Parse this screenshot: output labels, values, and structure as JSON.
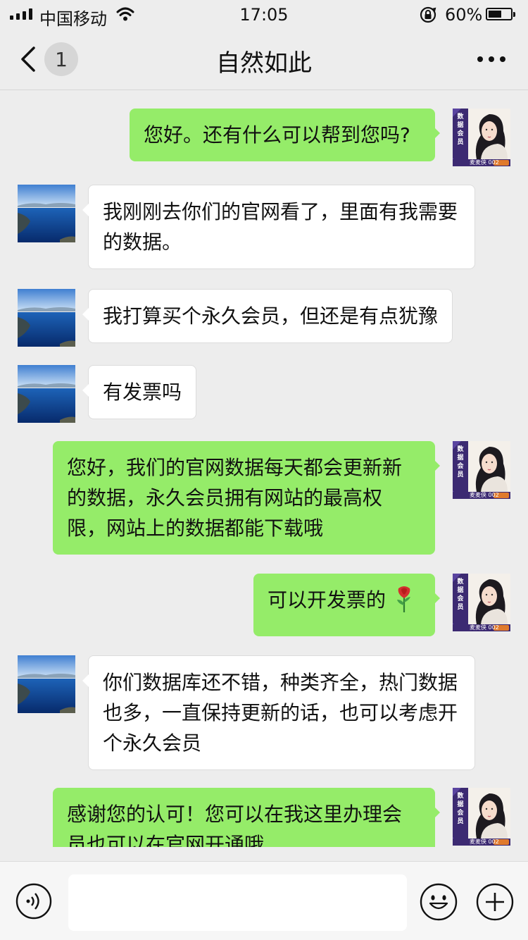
{
  "status_bar": {
    "carrier": "中国移动",
    "time": "17:05",
    "battery_percent_text": "60%",
    "battery_level": 0.6
  },
  "nav": {
    "unread_count": "1",
    "title": "自然如此"
  },
  "colors": {
    "self_bubble": "#95ec69",
    "other_bubble": "#ffffff",
    "background": "#ededed"
  },
  "messages": [
    {
      "from": "self",
      "text": "您好。还有什么可以帮到您吗?"
    },
    {
      "from": "other",
      "text": "我刚刚去你们的官网看了，里面有我需要的数据。"
    },
    {
      "from": "other",
      "text": "我打算买个永久会员，但还是有点犹豫"
    },
    {
      "from": "other",
      "text": "有发票吗"
    },
    {
      "from": "self",
      "text": "您好，我们的官网数据每天都会更新新的数据，永久会员拥有网站的最高权限，网站上的数据都能下载哦"
    },
    {
      "from": "self",
      "text": "可以开发票的",
      "emoji": "rose-emoji"
    },
    {
      "from": "other",
      "text": "你们数据库还不错，种类齐全，热门数据也多，一直保持更新的话，也可以考虑开个永久会员"
    },
    {
      "from": "self",
      "text": "感谢您的认可！您可以在我这里办理会员也可以在官网开通哦"
    }
  ],
  "self_avatar": {
    "lines": [
      "数",
      "据",
      "会",
      "员"
    ],
    "tag": "麦麦侠 002"
  },
  "icons": [
    "back-chevron-icon",
    "more-dots-icon",
    "voice-icon",
    "emoji-icon",
    "plus-icon",
    "wifi-icon",
    "signal-icon",
    "rotation-lock-icon",
    "battery-icon"
  ]
}
